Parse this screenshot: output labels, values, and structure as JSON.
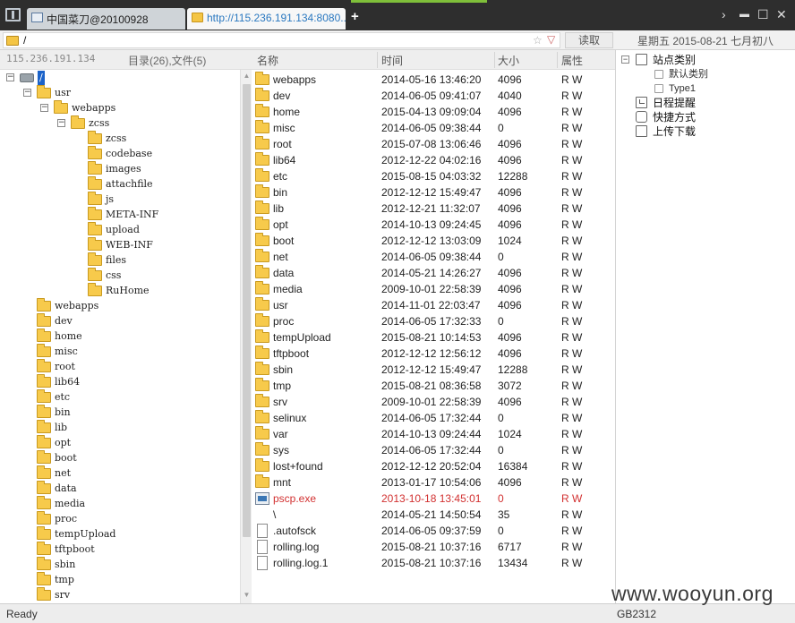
{
  "window": {
    "tabs": [
      {
        "label": "中国菜刀@20100928"
      },
      {
        "label": "http://115.236.191.134:8080..."
      }
    ],
    "new_tab": "+",
    "controls": {
      "chevron": "›",
      "minimize": "▬",
      "maximize": "☐",
      "close": "✕"
    }
  },
  "address": {
    "path": "/",
    "star": "☆",
    "dropdown": "▽",
    "read_label": "读取",
    "date_text": "星期五 2015-08-21 七月初八"
  },
  "left": {
    "host": "115.236.191.134",
    "summary": "目录(26),文件(5)",
    "tree": [
      {
        "label": "/",
        "depth": 0,
        "expanded": true,
        "selected": true,
        "drive": true
      },
      {
        "label": "usr",
        "depth": 1,
        "expanded": true
      },
      {
        "label": "webapps",
        "depth": 2,
        "expanded": true
      },
      {
        "label": "zcss",
        "depth": 3,
        "expanded": true
      },
      {
        "label": "zcss",
        "depth": 4
      },
      {
        "label": "codebase",
        "depth": 4
      },
      {
        "label": "images",
        "depth": 4
      },
      {
        "label": "attachfile",
        "depth": 4
      },
      {
        "label": "js",
        "depth": 4
      },
      {
        "label": "META-INF",
        "depth": 4
      },
      {
        "label": "upload",
        "depth": 4
      },
      {
        "label": "WEB-INF",
        "depth": 4
      },
      {
        "label": "files",
        "depth": 4
      },
      {
        "label": "css",
        "depth": 4
      },
      {
        "label": "RuHome",
        "depth": 4
      },
      {
        "label": "webapps",
        "depth": 1
      },
      {
        "label": "dev",
        "depth": 1
      },
      {
        "label": "home",
        "depth": 1
      },
      {
        "label": "misc",
        "depth": 1
      },
      {
        "label": "root",
        "depth": 1
      },
      {
        "label": "lib64",
        "depth": 1
      },
      {
        "label": "etc",
        "depth": 1
      },
      {
        "label": "bin",
        "depth": 1
      },
      {
        "label": "lib",
        "depth": 1
      },
      {
        "label": "opt",
        "depth": 1
      },
      {
        "label": "boot",
        "depth": 1
      },
      {
        "label": "net",
        "depth": 1
      },
      {
        "label": "data",
        "depth": 1
      },
      {
        "label": "media",
        "depth": 1
      },
      {
        "label": "proc",
        "depth": 1
      },
      {
        "label": "tempUpload",
        "depth": 1
      },
      {
        "label": "tftpboot",
        "depth": 1
      },
      {
        "label": "sbin",
        "depth": 1
      },
      {
        "label": "tmp",
        "depth": 1
      },
      {
        "label": "srv",
        "depth": 1
      }
    ]
  },
  "files": {
    "columns": {
      "name": "名称",
      "time": "时间",
      "size": "大小",
      "attr": "属性"
    },
    "rows": [
      {
        "icon": "folder",
        "name": "webapps",
        "time": "2014-05-16 13:46:20",
        "size": "4096",
        "attr": "R W"
      },
      {
        "icon": "folder",
        "name": "dev",
        "time": "2014-06-05 09:41:07",
        "size": "4040",
        "attr": "R W"
      },
      {
        "icon": "folder",
        "name": "home",
        "time": "2015-04-13 09:09:04",
        "size": "4096",
        "attr": "R W"
      },
      {
        "icon": "folder",
        "name": "misc",
        "time": "2014-06-05 09:38:44",
        "size": "0",
        "attr": "R W"
      },
      {
        "icon": "folder",
        "name": "root",
        "time": "2015-07-08 13:06:46",
        "size": "4096",
        "attr": "R W"
      },
      {
        "icon": "folder",
        "name": "lib64",
        "time": "2012-12-22 04:02:16",
        "size": "4096",
        "attr": "R W"
      },
      {
        "icon": "folder",
        "name": "etc",
        "time": "2015-08-15 04:03:32",
        "size": "12288",
        "attr": "R W"
      },
      {
        "icon": "folder",
        "name": "bin",
        "time": "2012-12-12 15:49:47",
        "size": "4096",
        "attr": "R W"
      },
      {
        "icon": "folder",
        "name": "lib",
        "time": "2012-12-21 11:32:07",
        "size": "4096",
        "attr": "R W"
      },
      {
        "icon": "folder",
        "name": "opt",
        "time": "2014-10-13 09:24:45",
        "size": "4096",
        "attr": "R W"
      },
      {
        "icon": "folder",
        "name": "boot",
        "time": "2012-12-12 13:03:09",
        "size": "1024",
        "attr": "R W"
      },
      {
        "icon": "folder",
        "name": "net",
        "time": "2014-06-05 09:38:44",
        "size": "0",
        "attr": "R W"
      },
      {
        "icon": "folder",
        "name": "data",
        "time": "2014-05-21 14:26:27",
        "size": "4096",
        "attr": "R W"
      },
      {
        "icon": "folder",
        "name": "media",
        "time": "2009-10-01 22:58:39",
        "size": "4096",
        "attr": "R W"
      },
      {
        "icon": "folder",
        "name": "usr",
        "time": "2014-11-01 22:03:47",
        "size": "4096",
        "attr": "R W"
      },
      {
        "icon": "folder",
        "name": "proc",
        "time": "2014-06-05 17:32:33",
        "size": "0",
        "attr": "R W"
      },
      {
        "icon": "folder",
        "name": "tempUpload",
        "time": "2015-08-21 10:14:53",
        "size": "4096",
        "attr": "R W"
      },
      {
        "icon": "folder",
        "name": "tftpboot",
        "time": "2012-12-12 12:56:12",
        "size": "4096",
        "attr": "R W"
      },
      {
        "icon": "folder",
        "name": "sbin",
        "time": "2012-12-12 15:49:47",
        "size": "12288",
        "attr": "R W"
      },
      {
        "icon": "folder",
        "name": "tmp",
        "time": "2015-08-21 08:36:58",
        "size": "3072",
        "attr": "R W"
      },
      {
        "icon": "folder",
        "name": "srv",
        "time": "2009-10-01 22:58:39",
        "size": "4096",
        "attr": "R W"
      },
      {
        "icon": "folder",
        "name": "selinux",
        "time": "2014-06-05 17:32:44",
        "size": "0",
        "attr": "R W"
      },
      {
        "icon": "folder",
        "name": "var",
        "time": "2014-10-13 09:24:44",
        "size": "1024",
        "attr": "R W"
      },
      {
        "icon": "folder",
        "name": "sys",
        "time": "2014-06-05 17:32:44",
        "size": "0",
        "attr": "R W"
      },
      {
        "icon": "folder",
        "name": "lost+found",
        "time": "2012-12-12 20:52:04",
        "size": "16384",
        "attr": "R W"
      },
      {
        "icon": "folder",
        "name": "mnt",
        "time": "2013-01-17 10:54:06",
        "size": "4096",
        "attr": "R W"
      },
      {
        "icon": "exe",
        "name": "pscp.exe",
        "time": "2013-10-18 13:45:01",
        "size": "0",
        "attr": "R W",
        "highlight": true
      },
      {
        "icon": "none",
        "name": "\\",
        "time": "2014-05-21 14:50:54",
        "size": "35",
        "attr": "R W"
      },
      {
        "icon": "file",
        "name": ".autofsck",
        "time": "2014-06-05 09:37:59",
        "size": "0",
        "attr": "R W"
      },
      {
        "icon": "file",
        "name": "rolling.log",
        "time": "2015-08-21 10:37:16",
        "size": "6717",
        "attr": "R W"
      },
      {
        "icon": "file",
        "name": "rolling.log.1",
        "time": "2015-08-21 10:37:16",
        "size": "13434",
        "attr": "R W"
      }
    ]
  },
  "right": {
    "items": [
      {
        "label": "站点类别",
        "box": "−",
        "icon": "category",
        "depth": 0
      },
      {
        "label": "默认类别",
        "icon": "sub",
        "depth": 1
      },
      {
        "label": "Type1",
        "icon": "sub",
        "depth": 1
      },
      {
        "label": "日程提醒",
        "icon": "clock",
        "depth": 0
      },
      {
        "label": "快捷方式",
        "icon": "hand",
        "depth": 0
      },
      {
        "label": "上传下载",
        "icon": "transfer",
        "depth": 0
      }
    ]
  },
  "status": {
    "ready": "Ready",
    "encoding": "GB2312",
    "watermark": "www.wooyun.org"
  },
  "colors": {
    "selection": "#1c63c9",
    "highlight_row": "#d23131",
    "folder": "#f7ca4b",
    "titlebar": "#2e2e2e"
  }
}
